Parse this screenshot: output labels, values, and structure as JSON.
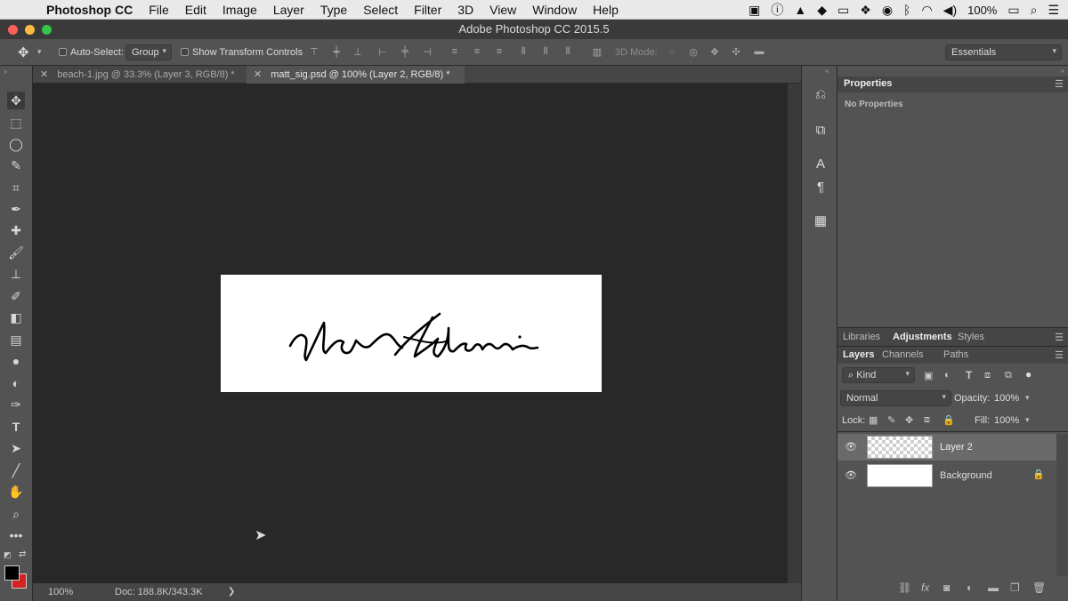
{
  "menubar": {
    "app": "Photoshop CC",
    "items": [
      "File",
      "Edit",
      "Image",
      "Layer",
      "Type",
      "Select",
      "Filter",
      "3D",
      "View",
      "Window",
      "Help"
    ],
    "battery": "100%"
  },
  "window": {
    "title": "Adobe Photoshop CC 2015.5"
  },
  "options": {
    "auto_select_label": "Auto-Select:",
    "auto_select_value": "Group",
    "transform_label": "Show Transform Controls",
    "mode_3d_label": "3D Mode:",
    "workspace": "Essentials"
  },
  "tabs": [
    {
      "label": "beach-1.jpg @ 33.3% (Layer 3, RGB/8) *"
    },
    {
      "label": "matt_sig.psd @ 100% (Layer 2, RGB/8) *"
    }
  ],
  "status": {
    "zoom": "100%",
    "doc": "Doc: 188.8K/343.3K"
  },
  "properties": {
    "tab": "Properties",
    "empty": "No Properties"
  },
  "panel_group2": {
    "tabs": [
      "Libraries",
      "Adjustments",
      "Styles"
    ]
  },
  "layers_panel": {
    "tabs": [
      "Layers",
      "Channels",
      "Paths"
    ],
    "filter": "Kind",
    "blend_mode": "Normal",
    "opacity_label": "Opacity:",
    "opacity": "100%",
    "lock_label": "Lock:",
    "fill_label": "Fill:",
    "fill": "100%",
    "layers": [
      {
        "name": "Layer 2"
      },
      {
        "name": "Background"
      }
    ]
  },
  "colors": {
    "foreground": "#000000",
    "background": "#d42121"
  }
}
